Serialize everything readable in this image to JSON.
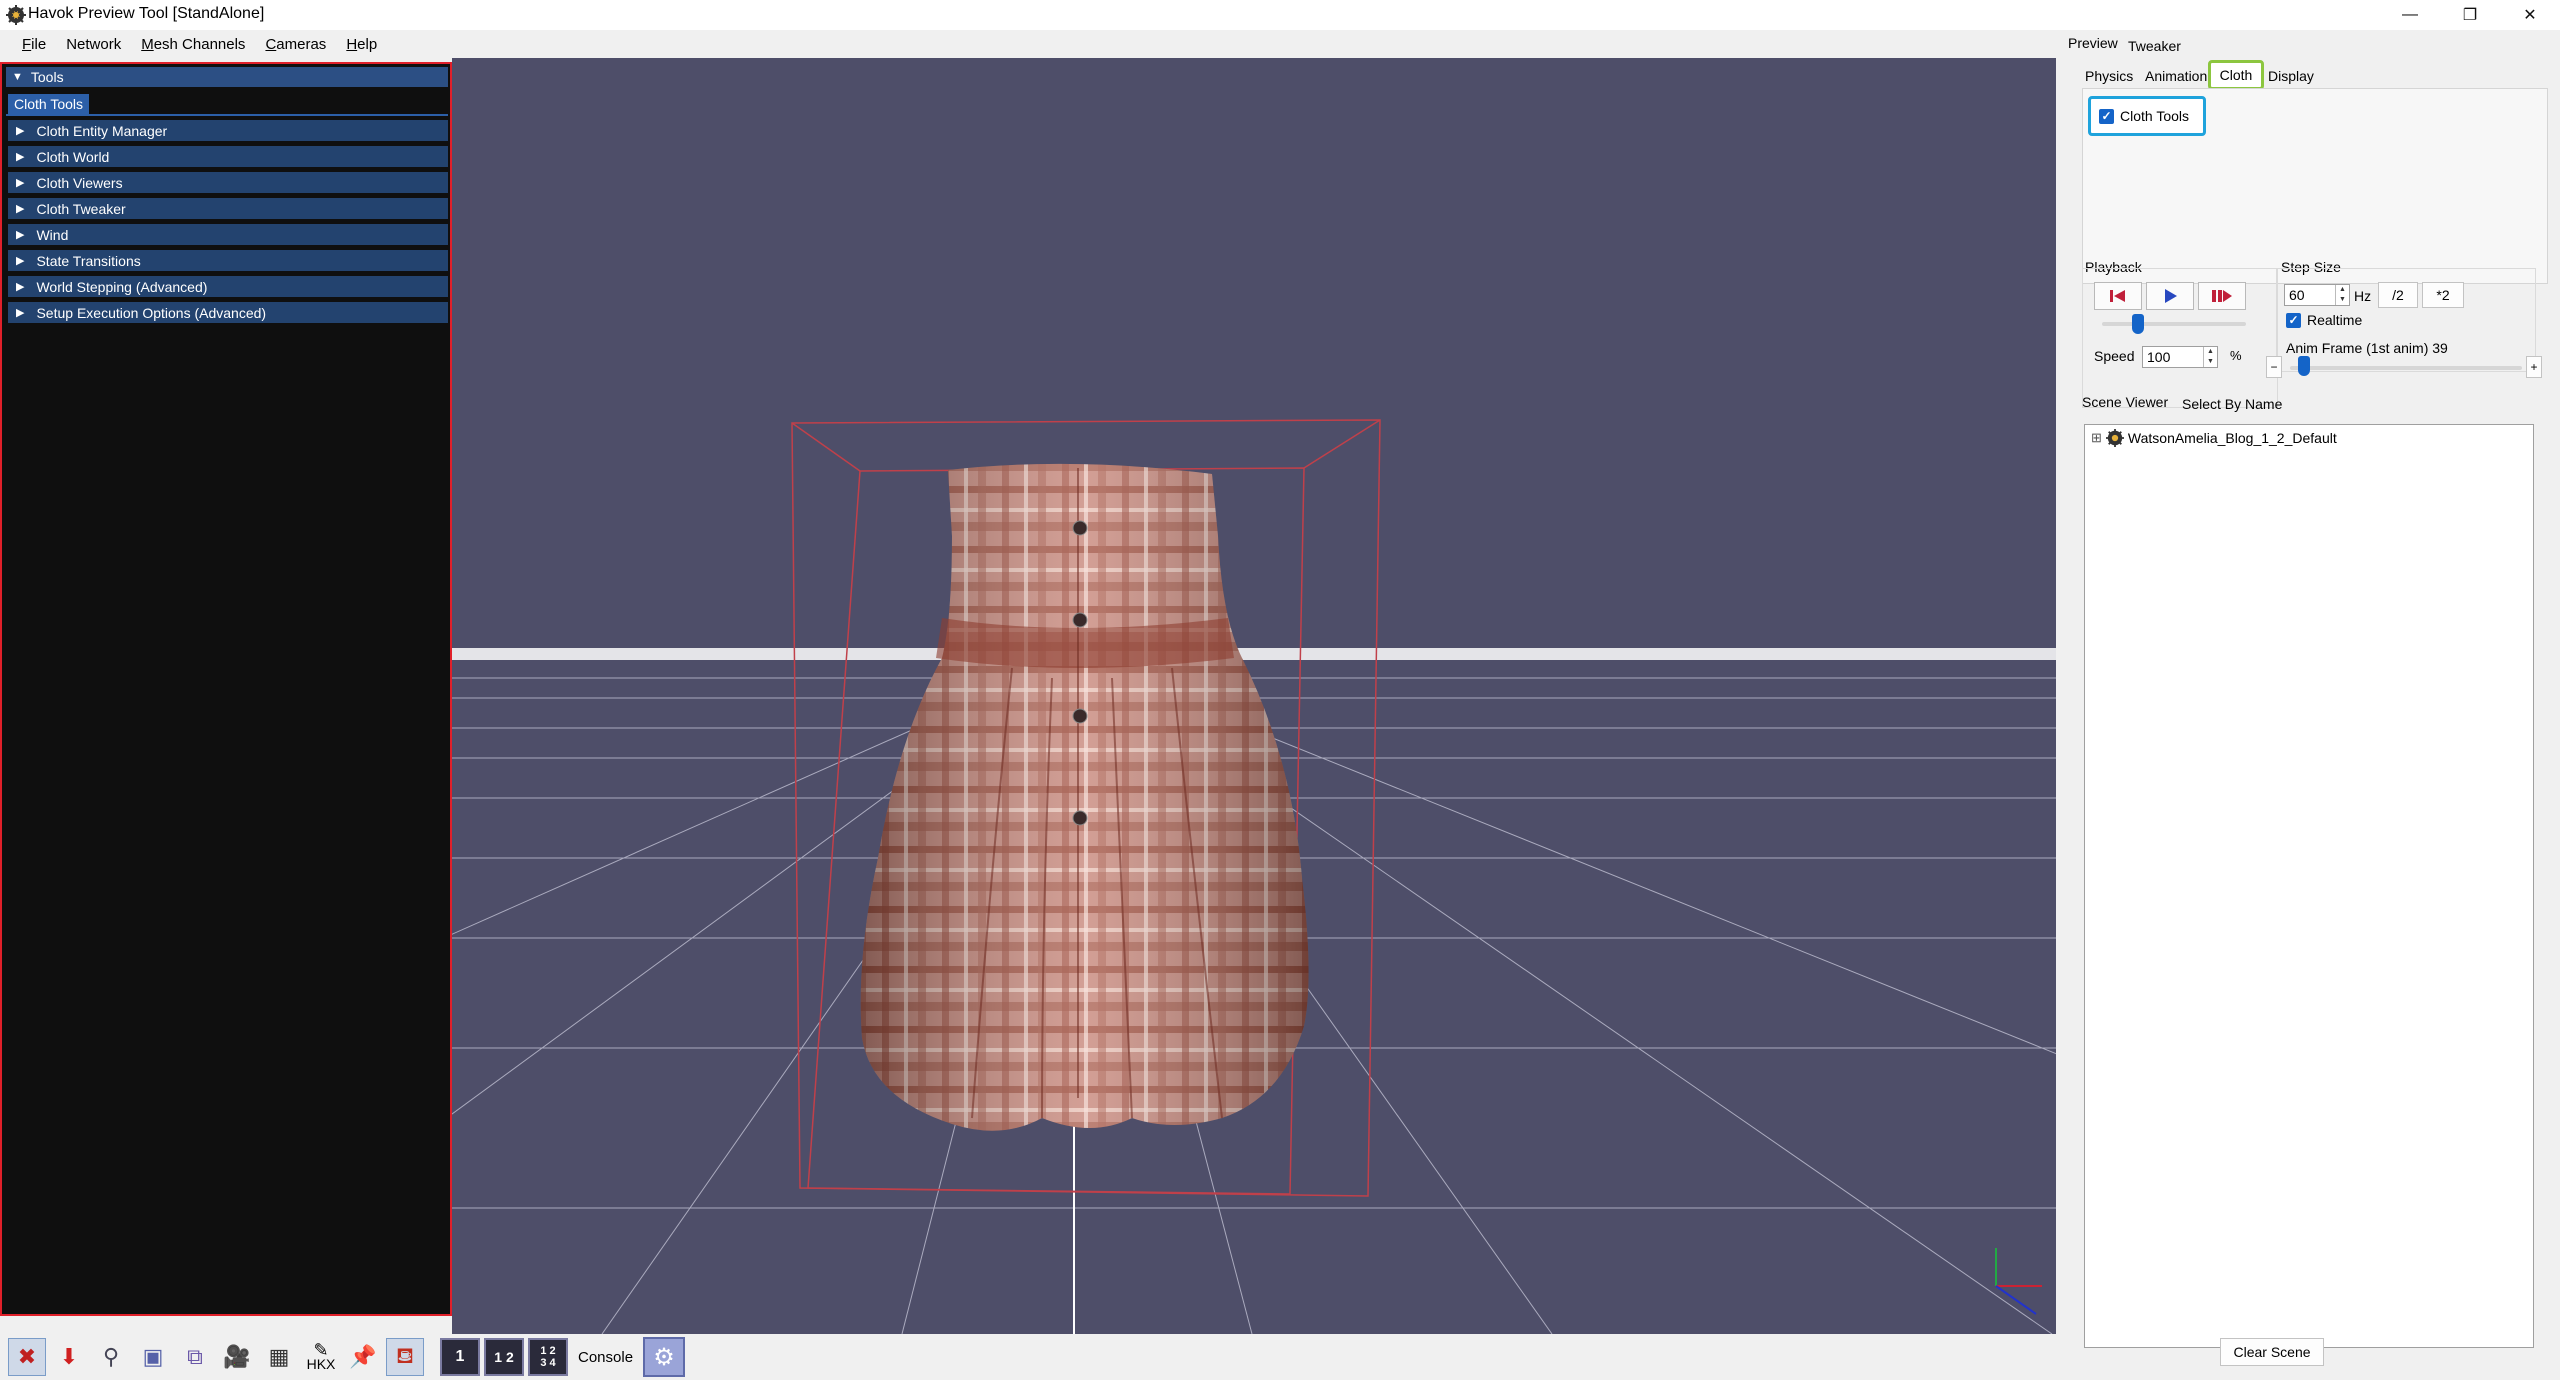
{
  "window": {
    "title": "Havok Preview Tool [StandAlone]",
    "controls": {
      "minimize": "—",
      "restore": "❐",
      "close": "✕"
    }
  },
  "menubar": [
    {
      "label": "File",
      "mnemonic": "F",
      "rest": "ile"
    },
    {
      "label": "Network",
      "mnemonic": "",
      "rest": "Network"
    },
    {
      "label": "Mesh Channels",
      "mnemonic": "M",
      "rest": "esh Channels"
    },
    {
      "label": "Cameras",
      "mnemonic": "C",
      "rest": "ameras"
    },
    {
      "label": "Help",
      "mnemonic": "H",
      "rest": "elp"
    }
  ],
  "tools": {
    "header": "Tools",
    "active_tab": "Cloth Tools",
    "sections": [
      "Cloth Entity Manager",
      "Cloth World",
      "Cloth Viewers",
      "Cloth Tweaker",
      "Wind",
      "State Transitions",
      "World Stepping (Advanced)",
      "Setup Execution Options (Advanced)"
    ]
  },
  "bottom_toolbar": {
    "hkx_label": "HKX",
    "layout_1": "1",
    "layout_2": "1 2",
    "layout_4": "1 2 3 4",
    "console_label": "Console",
    "icons": [
      "restart-icon",
      "drop-icon",
      "magnifier-icon",
      "box-icon",
      "multi-box-icon",
      "camera-icon",
      "grid-icon",
      "hkx-icon",
      "pin-icon",
      "cloth-icon"
    ]
  },
  "right_panel": {
    "top_tabs": [
      "Preview",
      "Tweaker"
    ],
    "sub_tabs": [
      "Physics",
      "Animation",
      "Cloth",
      "Display"
    ],
    "active_sub_tab": "Cloth",
    "cloth_tools_checkbox": "Cloth Tools",
    "playback": {
      "label": "Playback",
      "speed_label": "Speed",
      "speed_value": "100",
      "speed_unit": "%",
      "slider_fraction": 0.25
    },
    "step_size": {
      "label": "Step Size",
      "hz_value": "60",
      "hz_unit": "Hz",
      "half_button": "/2",
      "double_button": "*2",
      "realtime_label": "Realtime",
      "anim_frame_label": "Anim Frame (1st anim) 39",
      "minus": "−",
      "plus": "+",
      "anim_slider_fraction": 0.12
    },
    "scene_viewer": {
      "tabs": [
        "Scene Viewer",
        "Select By Name"
      ],
      "tree_root": "WatsonAmelia_Blog_1_2_Default",
      "expander": "⊞"
    },
    "clear_scene_button": "Clear Scene"
  },
  "colors": {
    "tools_highlight_border": "#e0202a",
    "cloth_tab_highlight": "#8cc63f",
    "cloth_tools_highlight": "#1fa3dc",
    "viewport_bg": "#4e4e69",
    "section_bg": "#23436f"
  }
}
